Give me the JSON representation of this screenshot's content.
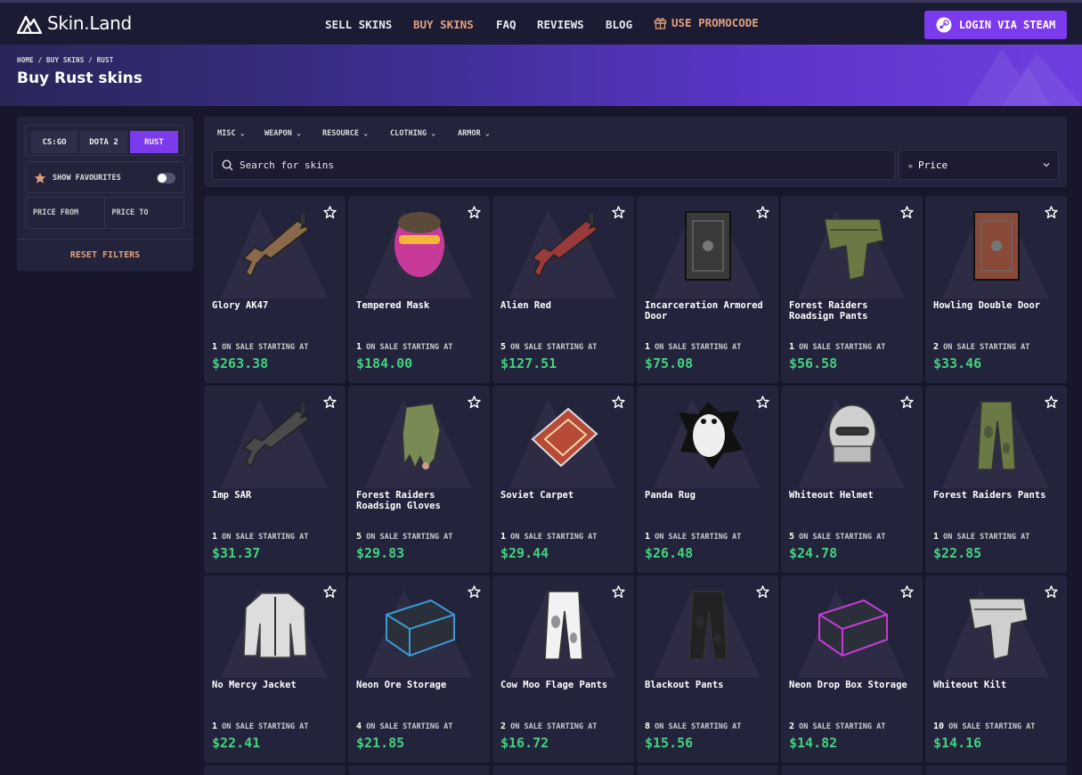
{
  "header": {
    "logo_text": "Skin.Land",
    "nav": [
      {
        "label": "SELL SKINS",
        "active": false
      },
      {
        "label": "BUY SKINS",
        "active": true
      },
      {
        "label": "FAQ",
        "active": false
      },
      {
        "label": "REVIEWS",
        "active": false
      },
      {
        "label": "BLOG",
        "active": false
      }
    ],
    "promo_label": "USE PROMOCODE",
    "login_label": "LOGIN VIA STEAM"
  },
  "hero": {
    "breadcrumb": "HOME / BUY SKINS / RUST",
    "title": "Buy Rust skins"
  },
  "sidebar": {
    "games": [
      "CS:GO",
      "DOTA 2",
      "RUST"
    ],
    "selected_game": "RUST",
    "show_favourites_label": "SHOW FAVOURITES",
    "show_favourites_on": false,
    "price_from_placeholder": "PRICE FROM",
    "price_to_placeholder": "PRICE TO",
    "reset_label": "RESET FILTERS"
  },
  "filters": {
    "categories": [
      "MISC",
      "WEAPON",
      "RESOURCE",
      "CLOTHING",
      "ARMOR"
    ],
    "search_placeholder": "Search for skins",
    "sort_value": "Price"
  },
  "sale_label": "ON SALE STARTING AT",
  "items": [
    {
      "name": "Glory AK47",
      "count": "1",
      "price": "$263.38",
      "icon": "rifle-icon",
      "color": "#8a6a4a"
    },
    {
      "name": "Tempered Mask",
      "count": "1",
      "price": "$184.00",
      "icon": "mask-icon",
      "color": "#c83a9a"
    },
    {
      "name": "Alien Red",
      "count": "5",
      "price": "$127.51",
      "icon": "rifle-icon",
      "color": "#9a3a3a"
    },
    {
      "name": "Incarceration Armored Door",
      "count": "1",
      "price": "$75.08",
      "icon": "door-icon",
      "color": "#3a3a3a"
    },
    {
      "name": "Forest Raiders Roadsign Pants",
      "count": "1",
      "price": "$56.58",
      "icon": "armor-pants-icon",
      "color": "#6b7a45"
    },
    {
      "name": "Howling Double Door",
      "count": "2",
      "price": "$33.46",
      "icon": "door-icon",
      "color": "#8a4a3a"
    },
    {
      "name": "Imp SAR",
      "count": "1",
      "price": "$31.37",
      "icon": "rifle-icon",
      "color": "#4a4a4a"
    },
    {
      "name": "Forest Raiders Roadsign Gloves",
      "count": "5",
      "price": "$29.83",
      "icon": "gloves-icon",
      "color": "#7a8a55"
    },
    {
      "name": "Soviet Carpet",
      "count": "1",
      "price": "$29.44",
      "icon": "carpet-icon",
      "color": "#b84a3a"
    },
    {
      "name": "Panda Rug",
      "count": "1",
      "price": "$26.48",
      "icon": "rug-icon",
      "color": "#eeeeee"
    },
    {
      "name": "Whiteout Helmet",
      "count": "5",
      "price": "$24.78",
      "icon": "helmet-icon",
      "color": "#cfcfcf"
    },
    {
      "name": "Forest Raiders Pants",
      "count": "1",
      "price": "$22.85",
      "icon": "pants-icon",
      "color": "#6b7a45"
    },
    {
      "name": "No Mercy Jacket",
      "count": "1",
      "price": "$22.41",
      "icon": "jacket-icon",
      "color": "#dddddd"
    },
    {
      "name": "Neon Ore Storage",
      "count": "4",
      "price": "$21.85",
      "icon": "box-icon",
      "color": "#3a9ad6"
    },
    {
      "name": "Cow Moo Flage Pants",
      "count": "2",
      "price": "$16.72",
      "icon": "pants-icon",
      "color": "#f2f2f2"
    },
    {
      "name": "Blackout Pants",
      "count": "8",
      "price": "$15.56",
      "icon": "pants-icon",
      "color": "#222222"
    },
    {
      "name": "Neon Drop Box Storage",
      "count": "2",
      "price": "$14.82",
      "icon": "box-icon",
      "color": "#c83ad6"
    },
    {
      "name": "Whiteout Kilt",
      "count": "10",
      "price": "$14.16",
      "icon": "armor-pants-icon",
      "color": "#cfcfcf"
    }
  ],
  "colors": {
    "accent": "#7c3aed",
    "price": "#43d17f",
    "highlight": "#e0a07e",
    "card_bg": "#24233c",
    "page_bg": "#17162b"
  }
}
